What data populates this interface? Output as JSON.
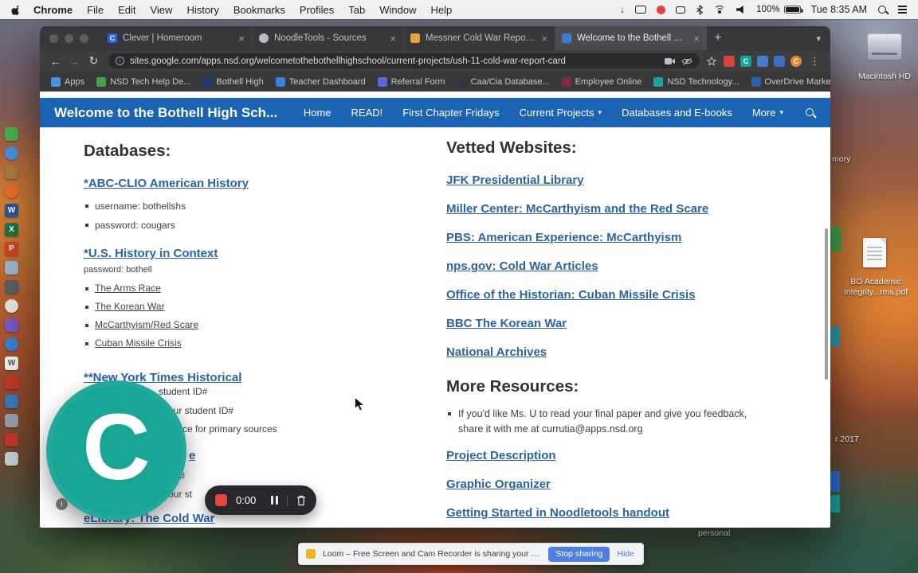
{
  "theme": {
    "site_header_blue": "#1b63b3",
    "link_blue": "#2a63a8",
    "loom_teal": "#17a596",
    "record_red": "#e8453c",
    "stop_button_blue": "#4e7fe1"
  },
  "icons": {
    "close": "×",
    "new_tab": "+",
    "chevron_down": "▾",
    "back_arrow": "←",
    "forward_arrow": "→",
    "reload": "↻",
    "overflow_chevron": "»",
    "menu_dots": "⋮",
    "download_arrow": "↓",
    "info": "i",
    "letter_c": "C"
  },
  "menubar": {
    "app_menus": [
      "Chrome",
      "File",
      "Edit",
      "View",
      "History",
      "Bookmarks",
      "Profiles",
      "Tab",
      "Window",
      "Help"
    ],
    "battery_label": "100%",
    "clock": "Tue 8:35 AM"
  },
  "browser": {
    "tabs": [
      {
        "title": "Clever | Homeroom",
        "favicon_letter": "C",
        "favicon_color": "#2d62e8"
      },
      {
        "title": "NoodleTools - Sources",
        "favicon_letter": "",
        "favicon_color": "#b9bec4"
      },
      {
        "title": "Messner Cold War Report Card",
        "favicon_letter": "",
        "favicon_color": "#e3a43b"
      },
      {
        "title": "Welcome to the Bothell High S",
        "favicon_letter": "",
        "favicon_color": "#3a7bd5"
      }
    ],
    "url": "sites.google.com/apps.nsd.org/welcometothebothellhighschool/current-projects/ush-11-cold-war-report-card",
    "bookmarks": [
      {
        "label": "Apps",
        "color": "#4a90e2"
      },
      {
        "label": "NSD Tech Help De...",
        "color": "#44a04a"
      },
      {
        "label": "Bothell High",
        "color": "#1d3a6e"
      },
      {
        "label": "Teacher Dashboard",
        "color": "#3f7fd4"
      },
      {
        "label": "Referral Form",
        "color": "#5a6acf"
      },
      {
        "label": "Caa/Cia Database...",
        "color": "#2e3440"
      },
      {
        "label": "Employee Online",
        "color": "#7a2e3a"
      },
      {
        "label": "NSD Technology...",
        "color": "#1fa5a0"
      },
      {
        "label": "OverDrive Market...",
        "color": "#2b5fa8"
      }
    ],
    "bookmarks_overflow": "»"
  },
  "site": {
    "title": "Welcome to the Bothell High Sch...",
    "nav": [
      {
        "label": "Home"
      },
      {
        "label": "READ!"
      },
      {
        "label": "First Chapter Fridays"
      },
      {
        "label": "Current Projects",
        "dropdown": true
      },
      {
        "label": "Databases and E-books"
      },
      {
        "label": "More",
        "dropdown": true
      }
    ]
  },
  "content": {
    "left": {
      "heading": "Databases:",
      "db1": {
        "title": "*ABC-CLIO American History",
        "bullets": [
          "username: bothellshs",
          "password: cougars"
        ]
      },
      "db2": {
        "title": "*U.S. History in Context",
        "note": "password: bothell",
        "topics": [
          "The Arms Race",
          "The Korean War",
          "McCarthyism/Red Scare",
          "Cuban Missile Crisis"
        ]
      },
      "db3": {
        "title": "**New York Times Historical"
      },
      "fragments": {
        "line1": "student ID#",
        "line2": "your student ID#",
        "line3": "rce for primary sources",
        "link_partial": "e",
        "line4": "nt ID#",
        "line5": "your st"
      },
      "db4": {
        "title": "eLibrary: The Cold War"
      }
    },
    "right": {
      "heading": "Vetted Websites:",
      "links": [
        "JFK Presidential Library",
        "Miller Center: McCarthyism and the Red Scare",
        "PBS: American Experience: McCarthyism",
        "nps.gov: Cold War Articles",
        "Office of the Historian: Cuban Missile Crisis",
        "BBC The Korean War",
        "National Archives"
      ],
      "more_heading": "More Resources:",
      "more_note": "If you'd like Ms. U to read your final paper and give you feedback, share it with me at currutia@apps.nsd.org",
      "more_links": [
        "Project Description",
        "Graphic Organizer",
        "Getting Started in Noodletools handout"
      ]
    }
  },
  "loom": {
    "bubble_letter": "C",
    "timer": "0:00",
    "banner_text": "Loom – Free Screen and Cam Recorder is sharing your screen.",
    "stop_button": "Stop sharing",
    "hide_link": "Hide"
  },
  "desktop": {
    "macintosh_hd": "Macintosh HD",
    "label_fragment_memory": "mory",
    "doc_label_line1": "BO Academic",
    "doc_label_line2": "Integrity...rms.pdf",
    "label_fragment_2017": "r 2017",
    "label_personal": "personal",
    "dock_icons": [
      {
        "color": "#4caf50",
        "radius": "4px"
      },
      {
        "color": "#4a90d9",
        "radius": "50%"
      },
      {
        "color": "#a8793f",
        "radius": "4px"
      },
      {
        "color": "#e8702a",
        "radius": "50%"
      },
      {
        "color": "#2b579a",
        "radius": "3px",
        "letter": "W"
      },
      {
        "color": "#217346",
        "radius": "3px",
        "letter": "X"
      },
      {
        "color": "#d04423",
        "radius": "3px",
        "letter": "P"
      },
      {
        "color": "#9fb6c9",
        "radius": "4px"
      },
      {
        "color": "#5a5e66",
        "radius": "4px"
      },
      {
        "color": "#e8e6e1",
        "radius": "50%"
      },
      {
        "color": "#7e57c2",
        "radius": "4px"
      },
      {
        "color": "#3f7fd4",
        "radius": "50%"
      },
      {
        "color": "#f0f0f0",
        "radius": "3px",
        "letter": "W",
        "letter_color": "#555555"
      },
      {
        "color": "#c0392b",
        "radius": "4px"
      },
      {
        "color": "#3878c0",
        "radius": "4px"
      },
      {
        "color": "#9aa0a6",
        "radius": "4px"
      },
      {
        "color": "#c0392b",
        "radius": "4px"
      },
      {
        "color": "#c9cdd2",
        "radius": "4px"
      }
    ]
  }
}
